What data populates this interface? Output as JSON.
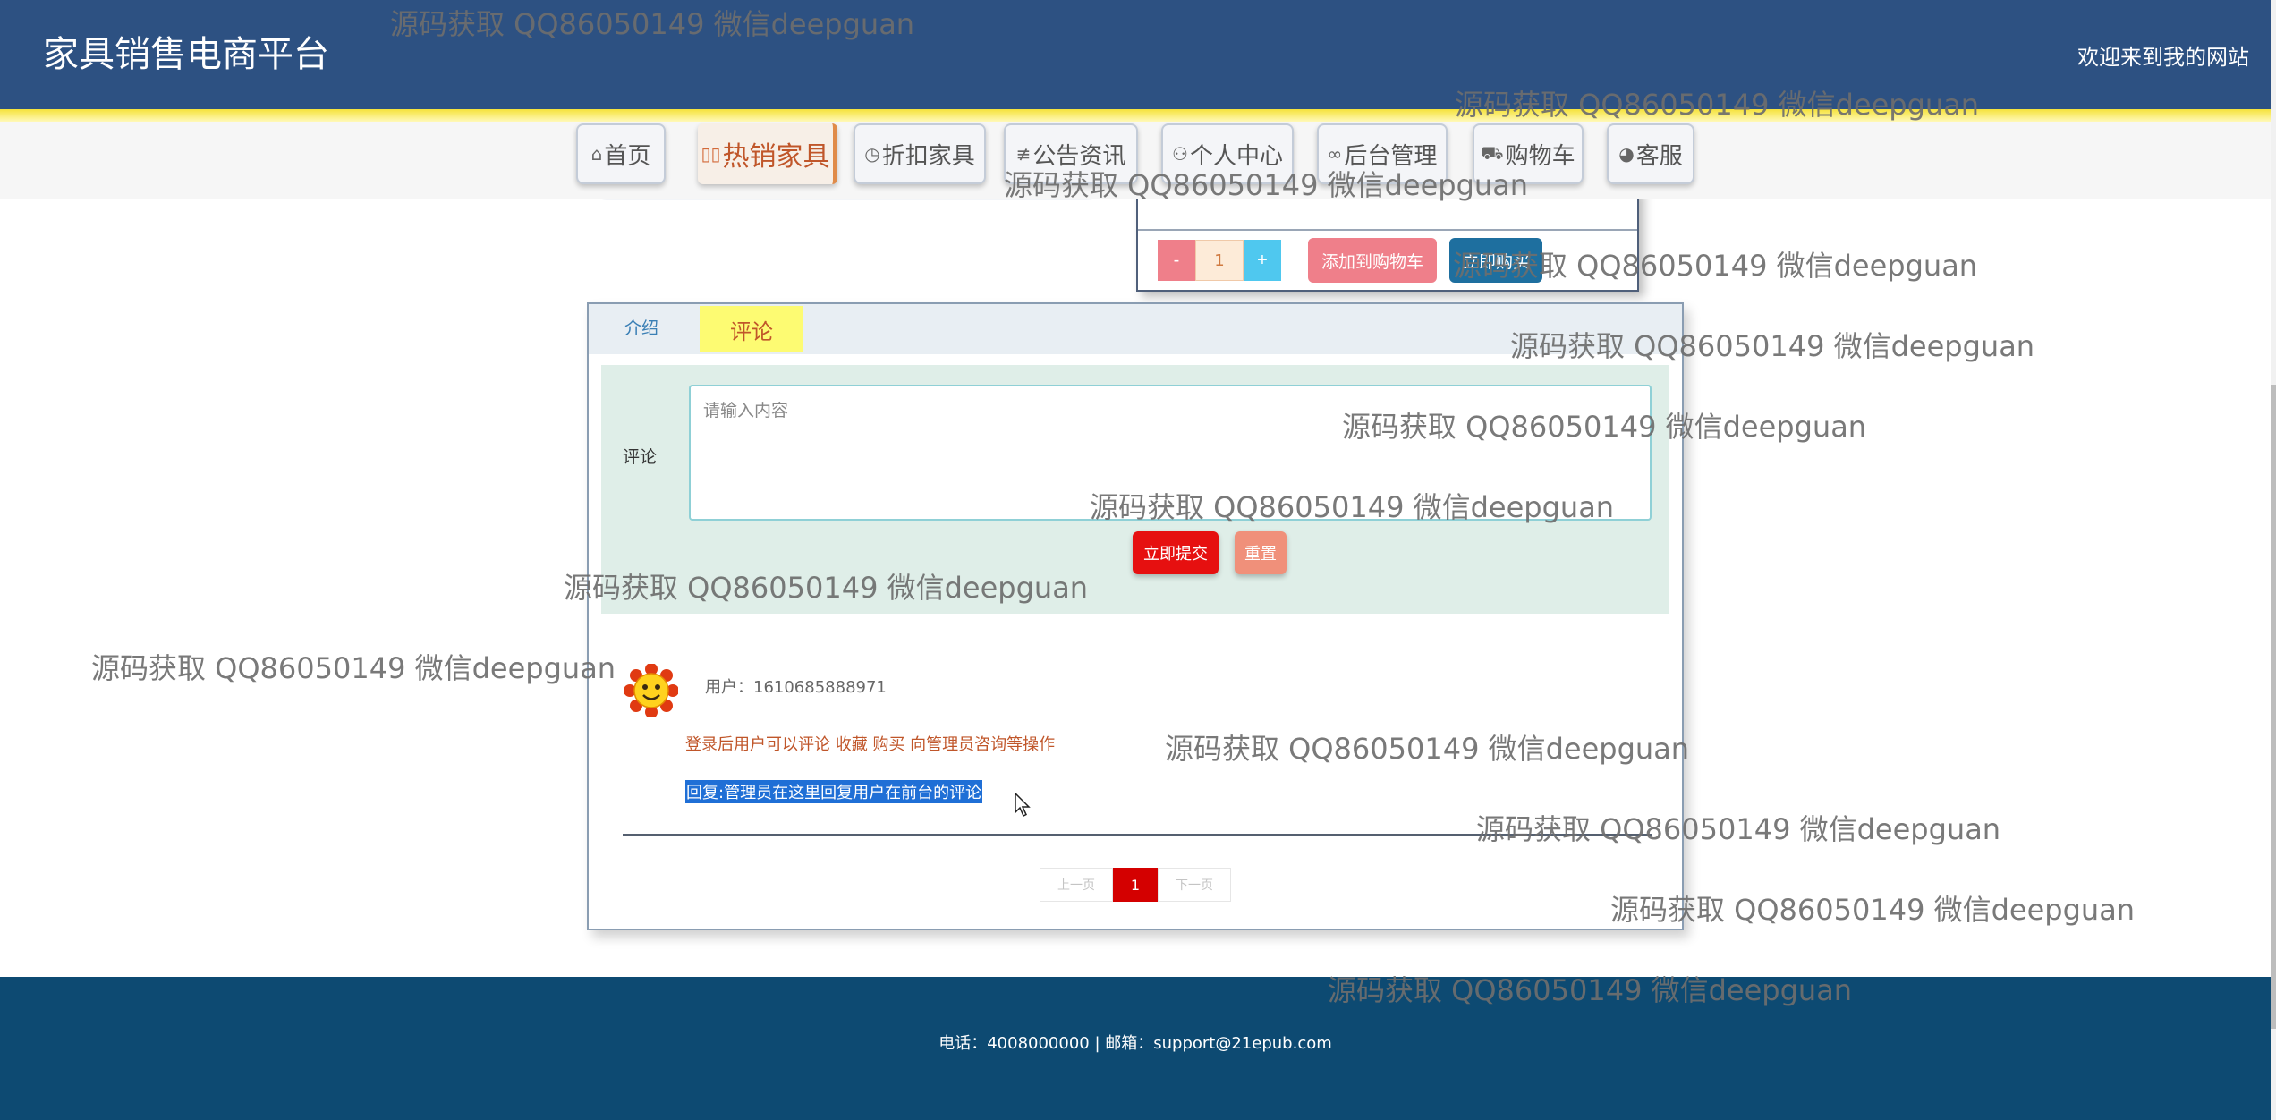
{
  "header": {
    "site_title": "家具销售电商平台",
    "welcome": "欢迎来到我的网站"
  },
  "nav": {
    "items": [
      {
        "label": "首页",
        "icon": "home-icon"
      },
      {
        "label": "热销家具",
        "icon": "hot-icon"
      },
      {
        "label": "折扣家具",
        "icon": "clock-icon"
      },
      {
        "label": "公告资讯",
        "icon": "sliders-icon"
      },
      {
        "label": "个人中心",
        "icon": "user-icon"
      },
      {
        "label": "后台管理",
        "icon": "link-icon"
      },
      {
        "label": "购物车",
        "icon": "cart-icon"
      },
      {
        "label": "客服",
        "icon": "chat-icon"
      }
    ],
    "active_item": "热销家具"
  },
  "purchase": {
    "minus_label": "-",
    "quantity": "1",
    "plus_label": "+",
    "add_to_cart_label": "添加到购物车",
    "buy_now_label": "立即购买"
  },
  "tabs": {
    "intro_label": "介绍",
    "comment_label": "评论"
  },
  "comment_form": {
    "label": "评论",
    "placeholder": "请输入内容",
    "submit_label": "立即提交",
    "reset_label": "重置"
  },
  "comment": {
    "user": "用户：1610685888971",
    "text": "登录后用户可以评论 收藏 购买 向管理员咨询等操作",
    "reply": "回复:管理员在这里回复用户在前台的评论"
  },
  "pagination": {
    "prev_label": "上一页",
    "current_page": "1",
    "next_label": "下一页"
  },
  "footer": {
    "contact": "电话：4008000000 | 邮箱：support@21epub.com"
  },
  "watermark": "源码获取 QQ86050149 微信deepguan",
  "colors": {
    "header_bg": "#2d5182",
    "footer_bg": "#0d4a72",
    "accent_yellow": "#f5e23a",
    "submit_red": "#e61010",
    "active_page": "#d40000"
  }
}
